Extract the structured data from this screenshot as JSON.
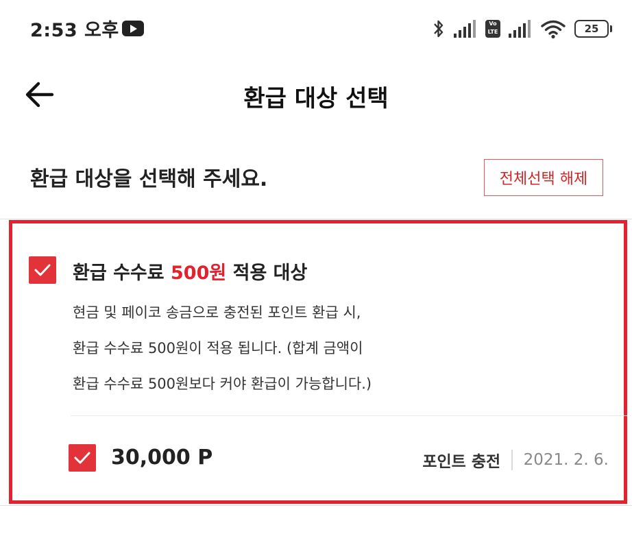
{
  "status_bar": {
    "time": "2:53 오후",
    "battery": "25",
    "volte_label": "Vo LTE"
  },
  "header": {
    "title": "환급 대상 선택"
  },
  "subheader": {
    "instruction": "환급 대상을 선택해 주세요.",
    "deselect_all_label": "전체선택 해제"
  },
  "refund_group": {
    "checked": true,
    "title_prefix": "환급 수수료 ",
    "title_fee": "500원",
    "title_suffix": " 적용 대상",
    "description_lines": [
      "현금 및 페이코 송금으로 충전된 포인트 환급 시,",
      "환급 수수료 500원이 적용 됩니다. (합계 금액이",
      "환급 수수료 500원보다 커야 환급이 가능합니다.)"
    ],
    "items": [
      {
        "checked": true,
        "amount": "30,000 P",
        "type": "포인트 충전",
        "date": "2021. 2. 6."
      }
    ]
  },
  "colors": {
    "accent_red": "#e3212f",
    "checkbox_red": "#e3333a"
  }
}
